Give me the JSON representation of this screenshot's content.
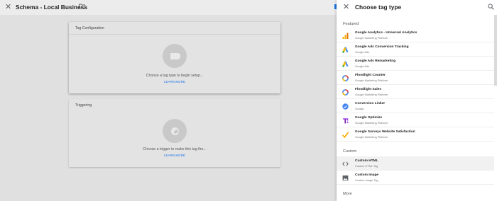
{
  "editor": {
    "title": "Schema - Local Business",
    "tag_configuration": {
      "heading": "Tag Configuration",
      "prompt": "Choose a tag type to begin setup...",
      "link": "LEARN MORE"
    },
    "triggering": {
      "heading": "Triggering",
      "prompt": "Choose a trigger to make this tag fire...",
      "link": "LEARN MORE"
    }
  },
  "panel": {
    "title": "Choose tag type",
    "sections": {
      "featured": "Featured",
      "custom": "Custom",
      "more": "More"
    },
    "featured_items": [
      {
        "name": "Google Analytics - Universal Analytics",
        "sub": "Google Marketing Platform",
        "icon": "analytics-icon"
      },
      {
        "name": "Google Ads Conversion Tracking",
        "sub": "Google Ads",
        "icon": "google-ads-icon"
      },
      {
        "name": "Google Ads Remarketing",
        "sub": "Google Ads",
        "icon": "google-ads-icon"
      },
      {
        "name": "Floodlight Counter",
        "sub": "Google Marketing Platform",
        "icon": "floodlight-icon"
      },
      {
        "name": "Floodlight Sales",
        "sub": "Google Marketing Platform",
        "icon": "floodlight-icon"
      },
      {
        "name": "Conversion Linker",
        "sub": "Google",
        "icon": "conversion-linker-icon"
      },
      {
        "name": "Google Optimize",
        "sub": "Google Marketing Platform",
        "icon": "optimize-icon"
      },
      {
        "name": "Google Surveys Website Satisfaction",
        "sub": "Google Marketing Platform",
        "icon": "surveys-icon"
      }
    ],
    "custom_items": [
      {
        "name": "Custom HTML",
        "sub": "Custom HTML Tag",
        "icon": "code-icon"
      },
      {
        "name": "Custom Image",
        "sub": "Custom Image Tag",
        "icon": "image-icon"
      }
    ]
  },
  "colors": {
    "accent": "#1a73e8",
    "overlay": "#e0e0e0"
  }
}
